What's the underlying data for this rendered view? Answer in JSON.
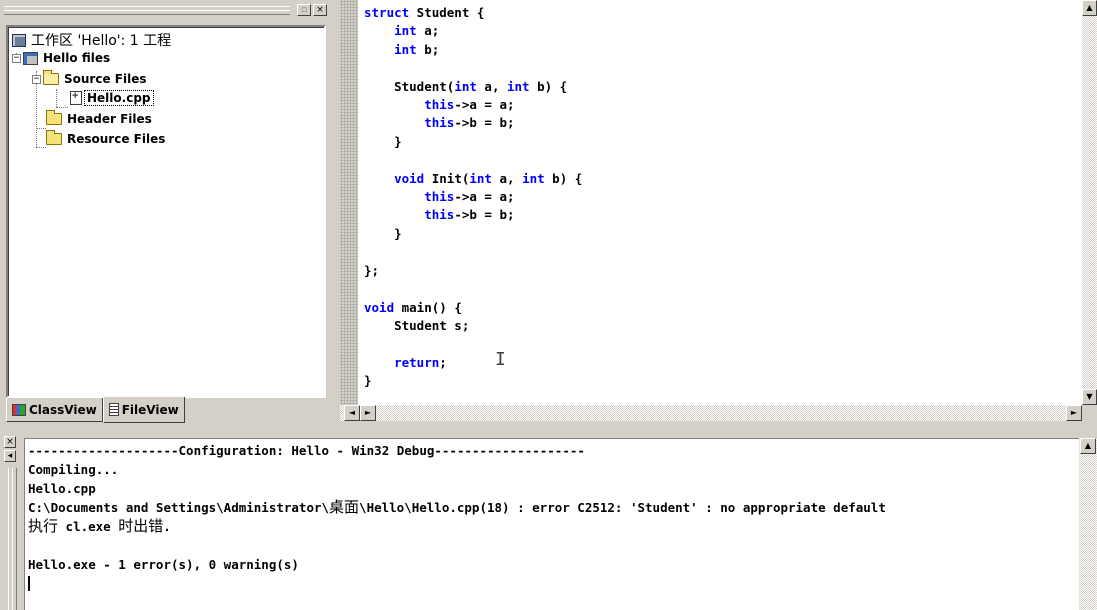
{
  "workspace": {
    "float_glyph": "▫",
    "close_glyph": "×",
    "tree": {
      "root_label": "工作区 'Hello': 1 工程",
      "project_label": "Hello files",
      "source_folder": "Source Files",
      "source_file": "Hello.cpp",
      "header_folder": "Header Files",
      "resource_folder": "Resource Files",
      "expand_glyph": "−"
    },
    "tabs": [
      {
        "label": "ClassView"
      },
      {
        "label": "FileView"
      }
    ]
  },
  "editor": {
    "file": "Hello.cpp",
    "code": [
      [
        {
          "t": "struct",
          "k": 1
        },
        {
          "t": " Student {"
        }
      ],
      [
        {
          "t": "    "
        },
        {
          "t": "int",
          "k": 1
        },
        {
          "t": " a;"
        }
      ],
      [
        {
          "t": "    "
        },
        {
          "t": "int",
          "k": 1
        },
        {
          "t": " b;"
        }
      ],
      [
        {
          "t": ""
        }
      ],
      [
        {
          "t": "    Student("
        },
        {
          "t": "int",
          "k": 1
        },
        {
          "t": " a, "
        },
        {
          "t": "int",
          "k": 1
        },
        {
          "t": " b) {"
        }
      ],
      [
        {
          "t": "        "
        },
        {
          "t": "this",
          "k": 1
        },
        {
          "t": "->a = a;"
        }
      ],
      [
        {
          "t": "        "
        },
        {
          "t": "this",
          "k": 1
        },
        {
          "t": "->b = b;"
        }
      ],
      [
        {
          "t": "    }"
        }
      ],
      [
        {
          "t": ""
        }
      ],
      [
        {
          "t": "    "
        },
        {
          "t": "void",
          "k": 1
        },
        {
          "t": " Init("
        },
        {
          "t": "int",
          "k": 1
        },
        {
          "t": " a, "
        },
        {
          "t": "int",
          "k": 1
        },
        {
          "t": " b) {"
        }
      ],
      [
        {
          "t": "        "
        },
        {
          "t": "this",
          "k": 1
        },
        {
          "t": "->a = a;"
        }
      ],
      [
        {
          "t": "        "
        },
        {
          "t": "this",
          "k": 1
        },
        {
          "t": "->b = b;"
        }
      ],
      [
        {
          "t": "    }"
        }
      ],
      [
        {
          "t": ""
        }
      ],
      [
        {
          "t": "};"
        }
      ],
      [
        {
          "t": ""
        }
      ],
      [
        {
          "t": "void",
          "k": 1
        },
        {
          "t": " main() {"
        }
      ],
      [
        {
          "t": "    Student s;"
        }
      ],
      [
        {
          "t": ""
        }
      ],
      [
        {
          "t": "    "
        },
        {
          "t": "return",
          "k": 1
        },
        {
          "t": ";"
        }
      ],
      [
        {
          "t": "}"
        }
      ]
    ],
    "keyword_color": "#0000ff",
    "cursor_glyph": "I",
    "scroll_up": "▲",
    "scroll_down": "▼",
    "scroll_left": "◄",
    "scroll_right": "►"
  },
  "output": {
    "close_glyph": "×",
    "float_glyph": "◂",
    "lines": [
      "--------------------Configuration: Hello - Win32 Debug--------------------",
      "Compiling...",
      "Hello.cpp",
      "C:\\Documents and Settings\\Administrator\\桌面\\Hello\\Hello.cpp(18) : error C2512: 'Student' : no appropriate default",
      "执行 cl.exe 时出错.",
      "",
      "Hello.exe - 1 error(s), 0 warning(s)"
    ],
    "scroll_up": "▲"
  }
}
